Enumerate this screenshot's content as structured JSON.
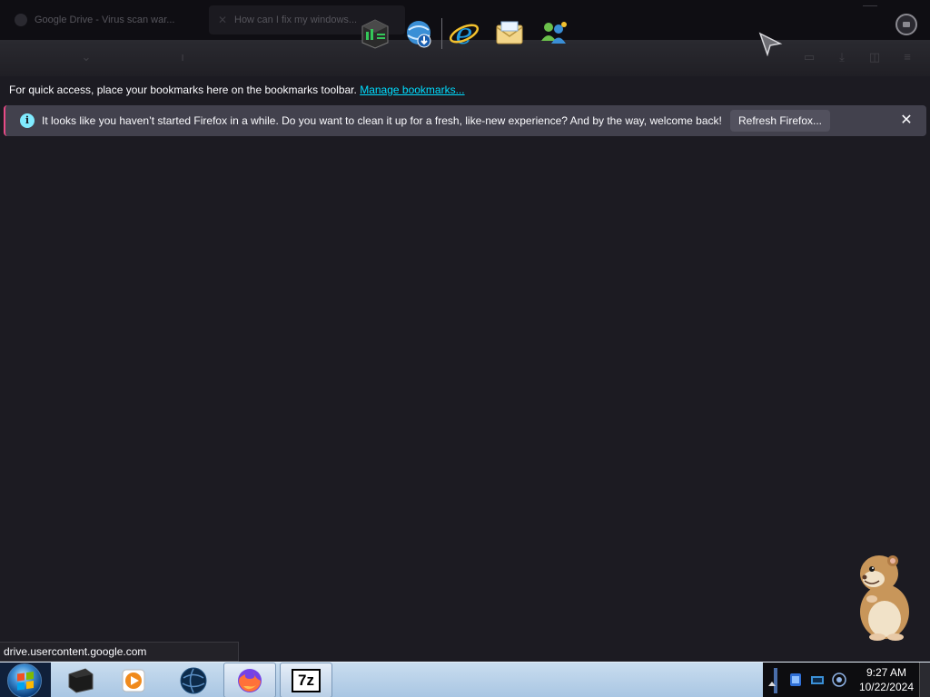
{
  "browser": {
    "tabs": [
      {
        "label": "Google Drive - Virus scan war..."
      },
      {
        "label": "How can I fix my windows..."
      }
    ]
  },
  "bookmarks_bar": {
    "text": "For quick access, place your bookmarks here on the bookmarks toolbar.",
    "link": "Manage bookmarks..."
  },
  "notification": {
    "message": "It looks like you haven’t started Firefox in a while. Do you want to clean it up for a fresh, like-new experience? And by the way, welcome back!",
    "button_label": "Refresh Firefox...",
    "close_label": "✕"
  },
  "status_link": "drive.usercontent.google.com",
  "dock": {
    "items": [
      "task-manager-icon",
      "internet-download-icon",
      "internet-explorer-icon",
      "mail-icon",
      "messenger-icon"
    ]
  },
  "taskbar": {
    "items": [
      "media-center-icon",
      "media-player-icon",
      "globe-app-icon",
      "firefox-icon",
      "7zip-icon"
    ],
    "active_item": "firefox-icon",
    "sevenzip_label": "7z"
  },
  "clock": {
    "time": "9:27 AM",
    "date": "10/22/2024"
  },
  "colors": {
    "accent_link": "#00ddff",
    "notification_bg": "#42414d",
    "content_bg": "#1c1b22",
    "taskbar_bg": "#a9c6e3"
  }
}
